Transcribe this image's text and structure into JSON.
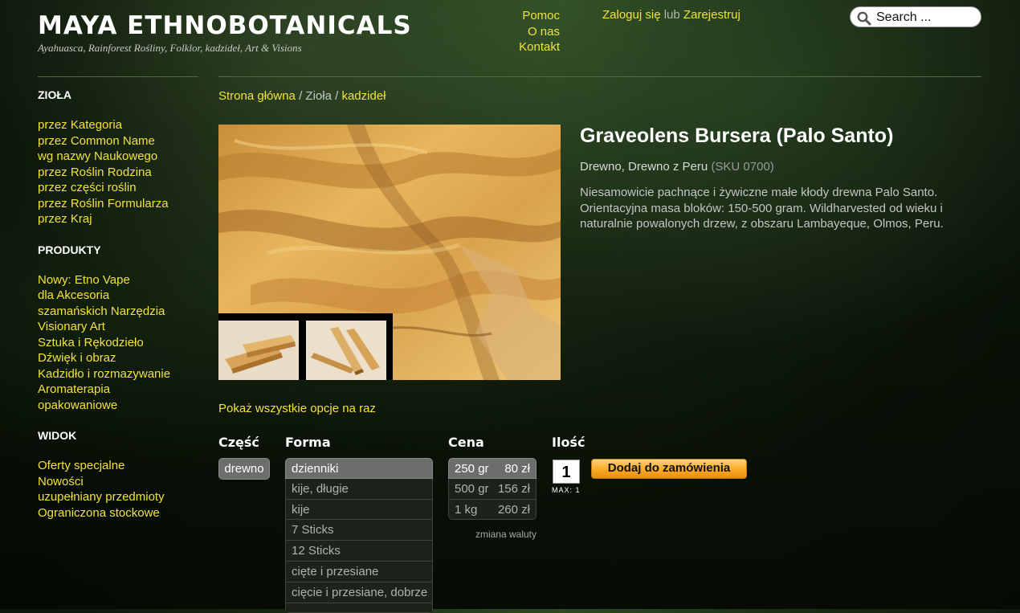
{
  "header": {
    "title": "MAYA ETHNOBOTANICALS",
    "tagline": "Ayahuasca, Rainforest Rośliny, Folklor, kadzideł, Art & Visions",
    "links": [
      "Pomoc",
      "O nas",
      "Kontakt"
    ],
    "login": "Zaloguj się",
    "or": "lub",
    "register": "Zarejestruj",
    "search_placeholder": "Search ..."
  },
  "sidebar": {
    "sections": [
      {
        "heading": "ZIOŁA",
        "items": [
          "przez Kategoria",
          "przez Common Name",
          "wg nazwy Naukowego",
          "przez Roślin Rodzina",
          "przez części roślin",
          "przez Roślin Formularza",
          "przez Kraj"
        ]
      },
      {
        "heading": "PRODUKTY",
        "items": [
          "Nowy: Etno Vape",
          "dla Akcesoria",
          "szamańskich Narzędzia",
          "Visionary Art",
          "Sztuka i Rękodzieło",
          "Dźwięk i obraz",
          "Kadzidło i rozmazywanie",
          "Aromaterapia",
          "opakowaniowe"
        ]
      },
      {
        "heading": "WIDOK",
        "items": [
          "Oferty specjalne",
          "Nowości",
          "uzupełniany przedmioty",
          "Ograniczona stockowe"
        ]
      }
    ]
  },
  "breadcrumb": {
    "home": "Strona główna",
    "sep": "/",
    "category": "Zioła",
    "current": "kadzideł"
  },
  "product": {
    "title": "Graveolens Bursera (Palo Santo)",
    "category": "Drewno, Drewno z Peru",
    "sku": "(SKU 0700)",
    "description": "Niesamowicie pachnące i żywiczne małe kłody drewna Palo Santo. Orientacyjna masa bloków: 150-500 gram. Wildharvested od wieku i naturalnie powalonych drzew, z obszaru Lambayeque, Olmos, Peru.",
    "show_all": "Pokaż wszystkie opcje na raz"
  },
  "options": {
    "part": {
      "label": "Część",
      "value": "drewno"
    },
    "form": {
      "label": "Forma",
      "items": [
        "dzienniki",
        "kije, długie",
        "kije",
        "7 Sticks",
        "12 Sticks",
        "cięte i przesiane",
        "cięcie i przesiane, dobrze"
      ],
      "selected": 0
    },
    "price": {
      "label": "Cena",
      "rows": [
        {
          "weight": "250 gr",
          "price": "80 zł"
        },
        {
          "weight": "500 gr",
          "price": "156 zł"
        },
        {
          "weight": "1 kg",
          "price": "260 zł"
        }
      ],
      "selected": 0,
      "currency_link": "zmiana waluty"
    },
    "quantity": {
      "label": "Ilość",
      "value": "1",
      "max": "MAX: 1"
    },
    "add_button": "Dodaj do zamówienia"
  }
}
